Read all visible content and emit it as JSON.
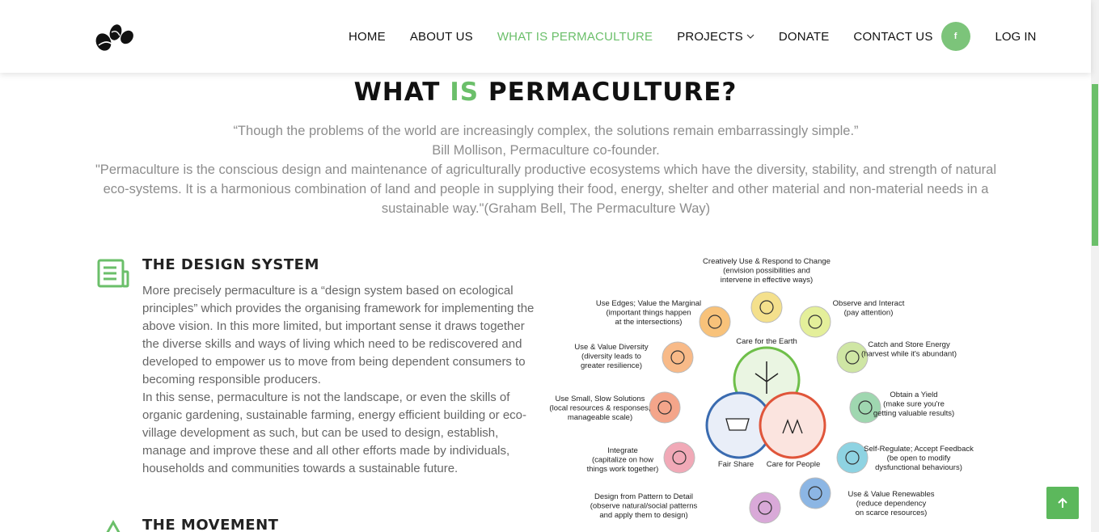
{
  "header": {
    "logo": "logo-mark",
    "nav": {
      "home": "HOME",
      "about": "ABOUT US",
      "permaculture": "WHAT IS PERMACULTURE",
      "projects": "PROJECTS",
      "donate": "DONATE",
      "contact": "CONTACT US"
    },
    "facebook": "f",
    "login": "LOG IN"
  },
  "page": {
    "title_part1": "WHAT ",
    "title_highlight": "IS",
    "title_part2": " PERMACULTURE?",
    "quote_line1": "“Though the problems of the world are increasingly complex, the solutions remain embarrassingly simple.”",
    "quote_line2": "Bill Mollison, Permaculture co-founder.",
    "quote_line3": "\"Permaculture is the conscious design and maintenance of agriculturally productive ecosystems which have the diversity, stability, and strength of natural eco-systems. It is a harmonious combination of land and people in supplying their food, energy, shelter and other material and non-material needs in a sustainable way.\"(Graham Bell, The Permaculture Way)"
  },
  "design_system": {
    "title": "THE DESIGN SYSTEM",
    "para1": "More precisely permaculture is a “design system based on ecological principles” which provides the organising framework for implementing the above vision. In this more limited, but important sense it draws together the diverse skills and ways of living which need to be rediscovered and developed to empower us to move from being dependent consumers to becoming responsible producers.",
    "para2": "In this sense, permaculture is not the landscape, or even the skills of organic gardening, sustainable farming, energy efficient building or eco-village development as such, but can be used to design, establish, manage and improve these and all other efforts made by individuals, households and communities towards a sustainable future."
  },
  "movement": {
    "title": "THE MOVEMENT"
  },
  "diagram": {
    "center": {
      "earth": "Care for the Earth",
      "fair": "Fair Share",
      "people": "Care for People"
    },
    "principles": [
      {
        "l1": "Creatively Use & Respond to Change",
        "l2": "(envision possibilities and",
        "l3": "intervene in effective ways)"
      },
      {
        "l1": "Observe and Interact",
        "l2": "(pay attention)",
        "l3": ""
      },
      {
        "l1": "Catch and Store Energy",
        "l2": "(harvest while it's abundant)",
        "l3": ""
      },
      {
        "l1": "Obtain a Yield",
        "l2": "(make sure you're",
        "l3": "getting valuable results)"
      },
      {
        "l1": "Self-Regulate; Accept Feedback",
        "l2": "(be open to modify",
        "l3": "dysfunctional behaviours)"
      },
      {
        "l1": "Use & Value Renewables",
        "l2": "(reduce dependency",
        "l3": "on scarce resources)"
      },
      {
        "l1": "Design from Pattern to Detail",
        "l2": "(observe natural/social patterns",
        "l3": "and apply them to design)"
      },
      {
        "l1": "Integrate",
        "l2": "(capitalize on how",
        "l3": "things work together)"
      },
      {
        "l1": "Use Small, Slow Solutions",
        "l2": "(local resources & responses,",
        "l3": "manageable scale)"
      },
      {
        "l1": "Use & Value Diversity",
        "l2": "(diversity leads to",
        "l3": "greater resilience)"
      },
      {
        "l1": "Use Edges; Value the Marginal",
        "l2": "(important things happen",
        "l3": "at the intersections)"
      }
    ],
    "colors": {
      "earth": "#6fbf4a",
      "fair": "#3a6bb0",
      "people": "#e0553a",
      "accent": "#6bbf6a"
    }
  },
  "back_to_top": "arrow-up-icon"
}
